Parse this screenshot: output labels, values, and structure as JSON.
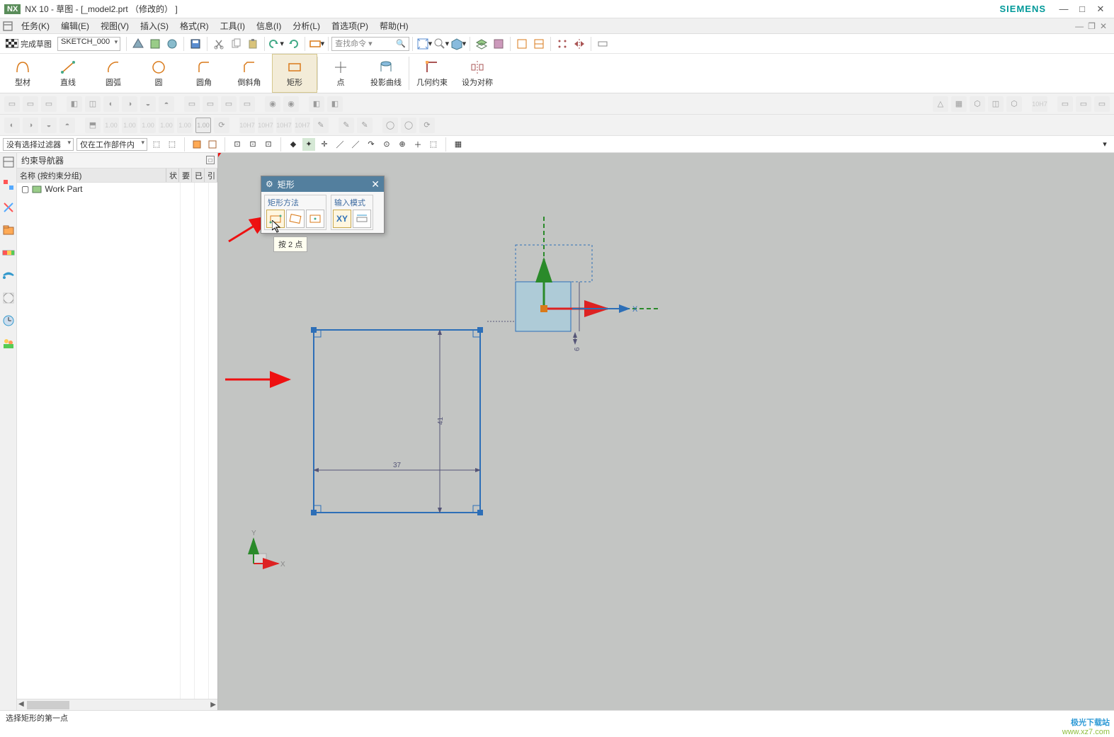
{
  "window": {
    "app": "NX",
    "title": "NX 10 - 草图 - [_model2.prt （修改的） ]",
    "brand": "SIEMENS"
  },
  "menus": [
    "任务(K)",
    "编辑(E)",
    "视图(V)",
    "插入(S)",
    "格式(R)",
    "工具(I)",
    "信息(I)",
    "分析(L)",
    "首选项(P)",
    "帮助(H)"
  ],
  "toolbar": {
    "finish_sketch": "完成草图",
    "sketch_name": "SKETCH_000",
    "search_placeholder": "查找命令"
  },
  "ribbon": [
    {
      "label": "型材"
    },
    {
      "label": "直线"
    },
    {
      "label": "圆弧"
    },
    {
      "label": "圆"
    },
    {
      "label": "圆角"
    },
    {
      "label": "倒斜角"
    },
    {
      "label": "矩形",
      "selected": true
    },
    {
      "label": "点"
    },
    {
      "label": "投影曲线"
    },
    {
      "label": "几何约束"
    },
    {
      "label": "设为对称"
    }
  ],
  "dim_small_labels": [
    "1.00",
    "1.00",
    "1.00",
    "1.00",
    "1.00",
    "1.00",
    "10H7",
    "10H7",
    "10H7",
    "10H7"
  ],
  "filters": {
    "left": "没有选择过滤器",
    "right": "仅在工作部件内"
  },
  "navigator": {
    "title": "约束导航器",
    "columns": [
      "名称 (按约束分组)",
      "状",
      "要",
      "已",
      "引"
    ],
    "root": "Work Part"
  },
  "dialog": {
    "title": "矩形",
    "group1": "矩形方法",
    "group2": "输入模式",
    "xy_label": "XY",
    "tooltip": "按 2 点"
  },
  "sketch": {
    "rect_w": "37",
    "rect_h": "41",
    "small_h": "6",
    "axis_x": "X",
    "axis_y": "Y"
  },
  "status": "选择矩形的第一点",
  "watermark": {
    "line1": "极光下载站",
    "line2": "www.xz7.com"
  }
}
